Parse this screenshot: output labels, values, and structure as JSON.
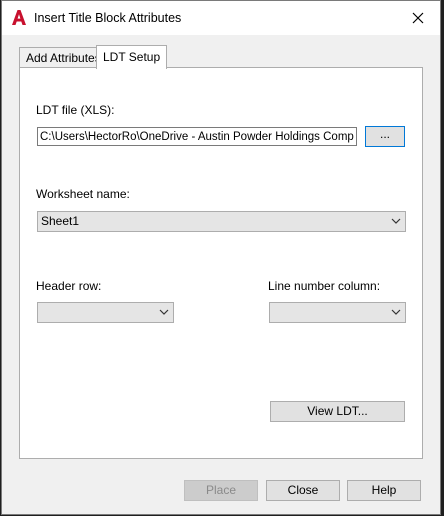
{
  "window": {
    "title": "Insert Title Block Attributes"
  },
  "tabs": [
    {
      "label": "Add Attributes",
      "active": false
    },
    {
      "label": "LDT Setup",
      "active": true
    }
  ],
  "ldt_file": {
    "label": "LDT file (XLS):",
    "value": "C:\\Users\\HectorRo\\OneDrive - Austin Powder Holdings Company\\",
    "browse_label": "..."
  },
  "worksheet": {
    "label": "Worksheet name:",
    "selected": "Sheet1"
  },
  "header_row": {
    "label": "Header row:",
    "selected": ""
  },
  "line_number_column": {
    "label": "Line number column:",
    "selected": ""
  },
  "view_ldt_label": "View LDT...",
  "footer": {
    "place_label": "Place",
    "close_label": "Close",
    "help_label": "Help"
  },
  "colors": {
    "app_icon_red": "#c8102e",
    "focus_blue": "#0078d7"
  }
}
